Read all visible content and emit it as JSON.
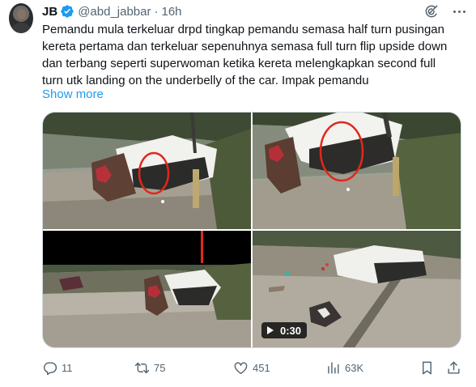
{
  "tweet": {
    "author_name": "JB",
    "handle": "@abd_jabbar",
    "separator": "·",
    "time": "16h",
    "text_lines": [
      "Pemandu mula terkeluar drpd tingkap pemandu semasa half turn pusingan",
      "kereta pertama dan terkeluar sepenuhnya semasa full turn flip upside down",
      "dan terbang seperti superwoman ketika kereta melengkapkan second full",
      "turn utk landing on the underbelly of the car. Impak pemandu"
    ],
    "show_more": "Show more"
  },
  "media": {
    "video_duration": "0:30"
  },
  "actions": {
    "replies": "11",
    "retweets": "75",
    "likes": "451",
    "views": "63K"
  },
  "colors": {
    "link_blue": "#1d9bf0",
    "secondary_text": "#536471",
    "annotation_red": "#e0281c"
  },
  "icons": [
    "verified-badge-icon",
    "grok-icon",
    "more-icon",
    "play-icon",
    "reply-icon",
    "retweet-icon",
    "like-icon",
    "views-icon",
    "bookmark-icon",
    "share-icon"
  ]
}
